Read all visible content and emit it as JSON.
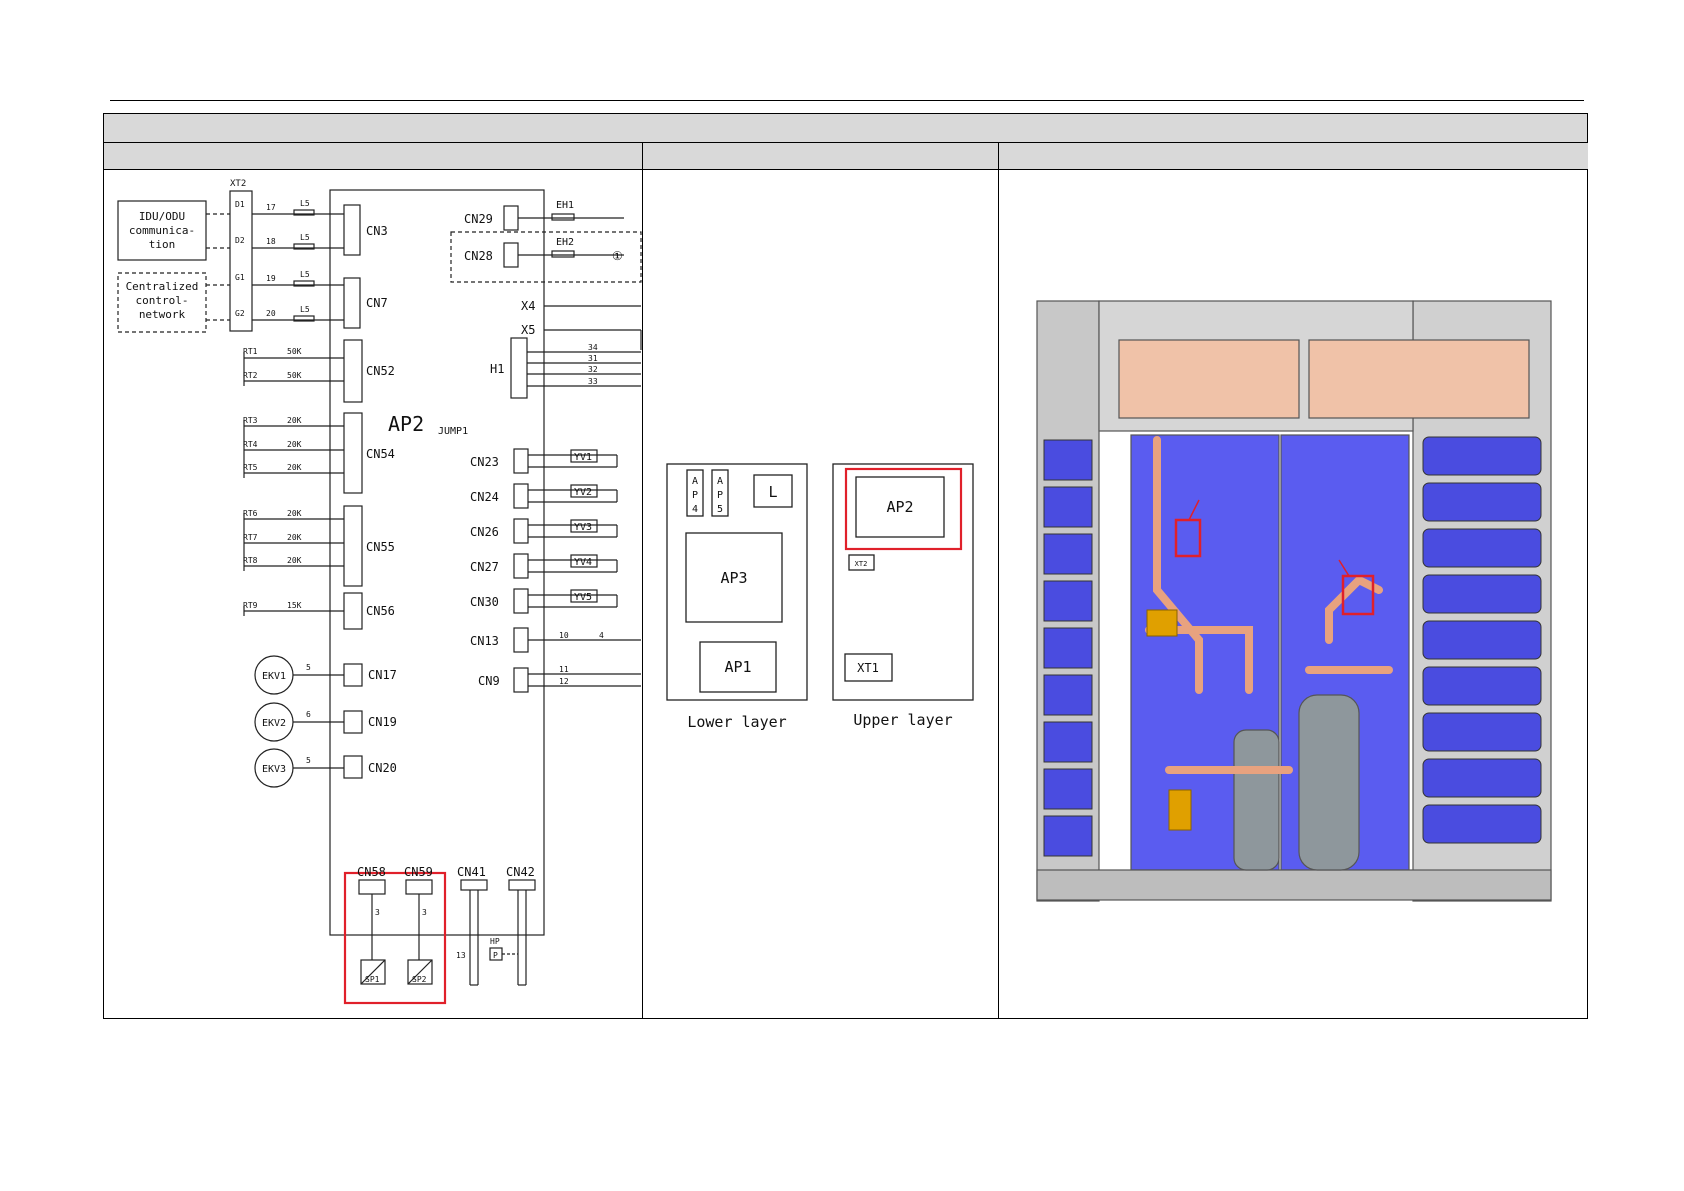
{
  "wiring": {
    "board": "AP2",
    "jumper": "JUMP1",
    "terminal_block": "XT2",
    "idu_odu_lines": [
      "IDU/ODU",
      "communica-",
      "tion"
    ],
    "central_lines": [
      "Centralized",
      "control-",
      "network"
    ],
    "xt2_terminals": [
      {
        "term": "D1",
        "wire": "17",
        "choke": "L5"
      },
      {
        "term": "D2",
        "wire": "18",
        "choke": "L5"
      },
      {
        "term": "G1",
        "wire": "19",
        "choke": "L5"
      },
      {
        "term": "G2",
        "wire": "20",
        "choke": "L5"
      }
    ],
    "left_connectors": [
      "CN3",
      "CN7",
      "CN52",
      "CN54",
      "CN55",
      "CN56",
      "CN17",
      "CN19",
      "CN20"
    ],
    "sensors": [
      {
        "id": "RT1",
        "val": "50K"
      },
      {
        "id": "RT2",
        "val": "50K"
      },
      {
        "id": "RT3",
        "val": "20K"
      },
      {
        "id": "RT4",
        "val": "20K"
      },
      {
        "id": "RT5",
        "val": "20K"
      },
      {
        "id": "RT6",
        "val": "20K"
      },
      {
        "id": "RT7",
        "val": "20K"
      },
      {
        "id": "RT8",
        "val": "20K"
      },
      {
        "id": "RT9",
        "val": "15K"
      }
    ],
    "ekv": [
      {
        "id": "EKV1",
        "wire": "5"
      },
      {
        "id": "EKV2",
        "wire": "6"
      },
      {
        "id": "EKV3",
        "wire": "5"
      }
    ],
    "heaters": [
      {
        "cn": "CN29",
        "label": "EH1"
      },
      {
        "cn": "CN28",
        "label": "EH2"
      }
    ],
    "note_mark": "①",
    "x_terms": [
      "X4",
      "X5"
    ],
    "h1": {
      "label": "H1",
      "wires": [
        "34",
        "31",
        "32",
        "33"
      ]
    },
    "valves": [
      {
        "cn": "CN23",
        "label": "YV1"
      },
      {
        "cn": "CN24",
        "label": "YV2"
      },
      {
        "cn": "CN26",
        "label": "YV3"
      },
      {
        "cn": "CN27",
        "label": "YV4"
      },
      {
        "cn": "CN30",
        "label": "YV5"
      }
    ],
    "cn13": {
      "label": "CN13",
      "w1": "10",
      "w2": "4"
    },
    "cn9": {
      "label": "CN9",
      "w1": "11",
      "w2": "12"
    },
    "bottom_connectors": [
      "CN58",
      "CN59",
      "CN41",
      "CN42"
    ],
    "pressure_sensors": [
      "SP1",
      "SP2"
    ],
    "wire_3": "3",
    "wire_13": "13",
    "hp": "HP",
    "p": "P"
  },
  "layout_panel": {
    "lower_caption": "Lower layer",
    "upper_caption": "Upper layer",
    "lower_boxes": [
      "AP3",
      "AP1",
      "L"
    ],
    "ap4_chars": [
      "A",
      "P",
      "4"
    ],
    "ap5_chars": [
      "A",
      "P",
      "5"
    ],
    "upper_boxes": [
      "AP2",
      "XT2",
      "XT1"
    ]
  },
  "colors": {
    "highlight": "#e0202a",
    "header_fill": "#d9d9d9",
    "panel_blue": "#5a5cf0",
    "copper": "#e8a27f"
  }
}
